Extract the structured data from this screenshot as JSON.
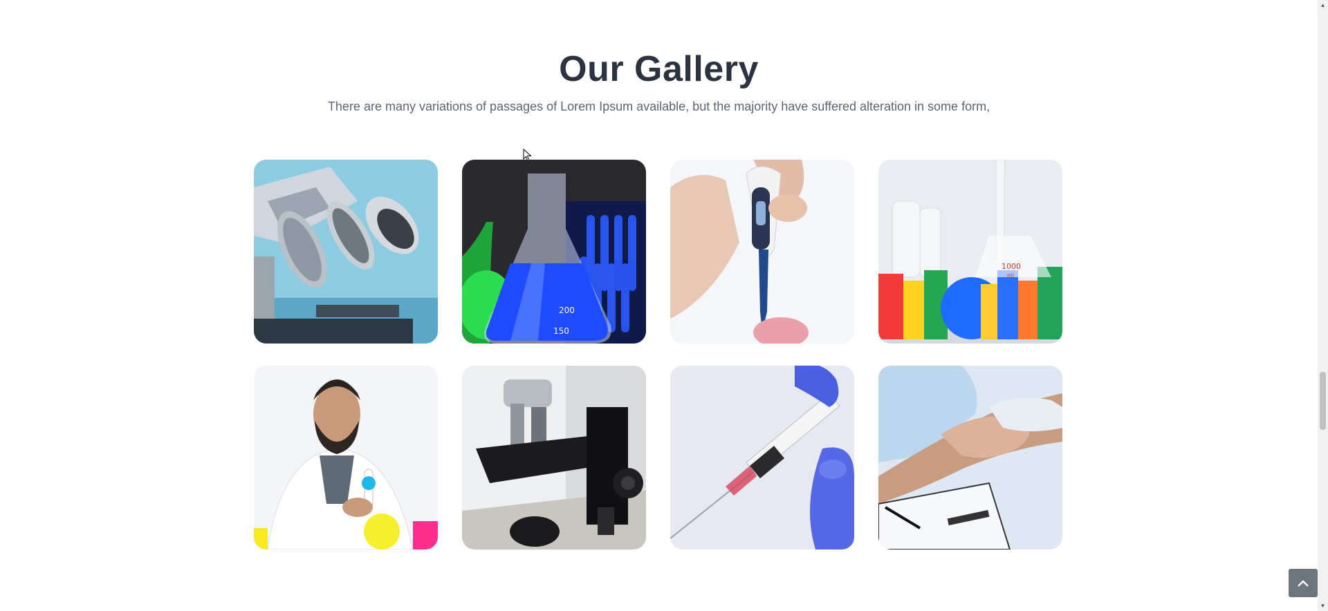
{
  "gallery": {
    "title": "Our Gallery",
    "subtitle": "There are many variations of passages of Lorem Ipsum available, but the majority have suffered alteration in some form,",
    "images": [
      {
        "subject": "microscope-lenses"
      },
      {
        "subject": "blue-lab-flask"
      },
      {
        "subject": "pipette-in-hand"
      },
      {
        "subject": "colorful-lab-glassware"
      },
      {
        "subject": "scientist-with-test-tubes"
      },
      {
        "subject": "microscope-stage"
      },
      {
        "subject": "syringe-with-glove"
      },
      {
        "subject": "hands-holding-clipboard"
      }
    ],
    "flask_marks": [
      "200",
      "150"
    ],
    "beaker_marks": [
      "1000",
      "ml"
    ]
  },
  "controls": {
    "back_to_top_icon": "chevron-up-icon",
    "scroll_up_icon": "triangle-up-icon",
    "scroll_down_icon": "triangle-down-icon"
  },
  "colors": {
    "title": "#2b3240",
    "subtitle": "#5d6471",
    "back_to_top_bg": "#6c757d"
  }
}
